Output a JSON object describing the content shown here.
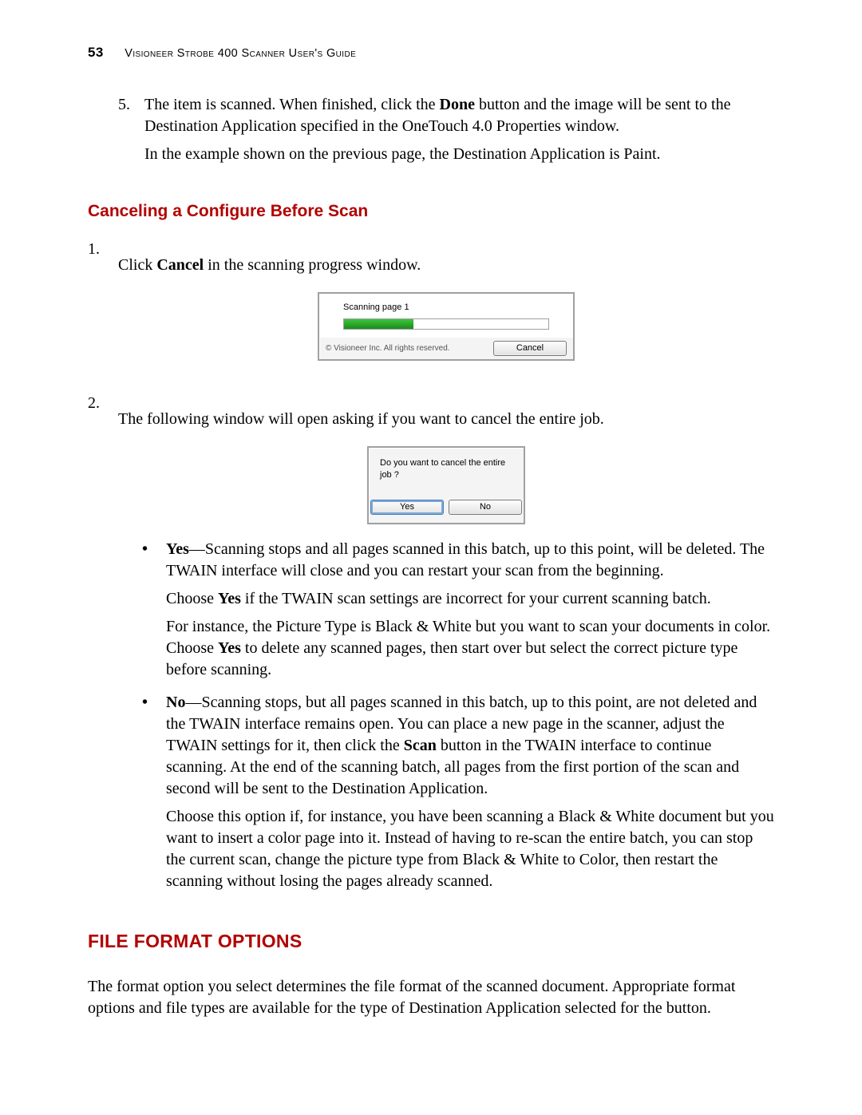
{
  "header": {
    "page_number": "53",
    "title_smallcaps": "Visioneer Strobe 400 Scanner User's Guide"
  },
  "step5": {
    "num": "5.",
    "text_before_bold": "The item is scanned. When finished, click the ",
    "bold": "Done",
    "text_after_bold": " button and the image will be sent to the Destination Application specified in the OneTouch 4.0 Properties window.",
    "second_para": "In the example shown on the previous page, the Destination Application is Paint."
  },
  "cancel_heading": "Canceling a Configure Before Scan",
  "step1": {
    "num": "1.",
    "text_before_bold": "Click ",
    "bold": "Cancel",
    "text_after_bold": " in the scanning progress window."
  },
  "progress_dialog": {
    "status": "Scanning page 1",
    "copyright": "© Visioneer Inc. All rights reserved.",
    "cancel_label": "Cancel"
  },
  "step2": {
    "num": "2.",
    "text": "The following window will open asking if you want to cancel the entire job."
  },
  "confirm_dialog": {
    "message": "Do you want to cancel the entire job ?",
    "yes_label": "Yes",
    "no_label": "No"
  },
  "bullets": {
    "yes": {
      "bold": "Yes",
      "p1_rest": "—Scanning stops and all pages scanned in this batch, up to this point, will be deleted. The TWAIN interface will close and you can restart your scan from the beginning.",
      "p2_before": "Choose ",
      "p2_bold": "Yes",
      "p2_after": " if the TWAIN scan settings are incorrect for your current scanning batch.",
      "p3_before": "For instance, the Picture Type is Black & White but you want to scan your documents in color. Choose ",
      "p3_bold": "Yes",
      "p3_after": " to delete any scanned pages, then start over but select the correct picture type before scanning."
    },
    "no": {
      "bold": "No",
      "p1_rest_a": "—Scanning stops, but all pages scanned in this batch, up to this point, are not deleted and the TWAIN interface remains open. You can place a new page in the scanner, adjust the TWAIN settings for it, then click the ",
      "p1_bold": "Scan",
      "p1_rest_b": " button in the TWAIN interface to continue scanning. At the end of the scanning batch, all pages from the first portion of the scan and second will be sent to the Destination Application.",
      "p2": "Choose this option if, for instance, you have been scanning a Black & White document but you want to insert a color page into it. Instead of having to re-scan the entire batch, you can stop the current scan, change the picture type from Black & White to Color, then restart the scanning without losing the pages already scanned."
    }
  },
  "file_format_heading": "File Format Options",
  "file_format_para": "The format option you select determines the file format of the scanned document. Appropriate format options and file types are available for the type of Destination Application selected for the button."
}
